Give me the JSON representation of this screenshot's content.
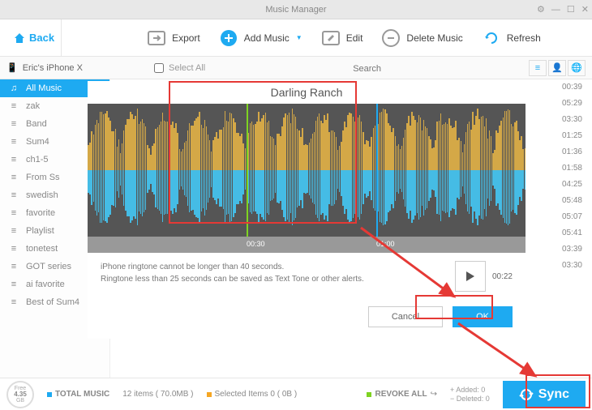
{
  "titlebar": {
    "title": "Music Manager"
  },
  "toolbar": {
    "back": "Back",
    "export": "Export",
    "add_music": "Add Music",
    "edit": "Edit",
    "delete_music": "Delete Music",
    "refresh": "Refresh"
  },
  "subheader": {
    "device": "Eric's iPhone X",
    "select_all": "Select All",
    "search_placeholder": "Search"
  },
  "sidebar": {
    "items": [
      {
        "label": "All Music",
        "icon": "♫"
      },
      {
        "label": "zak",
        "icon": "≡"
      },
      {
        "label": "Band",
        "icon": "≡"
      },
      {
        "label": "Sum4",
        "icon": "≡"
      },
      {
        "label": "ch1-5",
        "icon": "≡"
      },
      {
        "label": "From Ss",
        "icon": "≡"
      },
      {
        "label": "swedish",
        "icon": "≡"
      },
      {
        "label": "favorite",
        "icon": "≡"
      },
      {
        "label": "Playlist",
        "icon": "≡"
      },
      {
        "label": "tonetest",
        "icon": "≡"
      },
      {
        "label": "GOT series",
        "icon": "≡"
      },
      {
        "label": "ai favorite",
        "icon": "≡"
      },
      {
        "label": "Best of Sum4",
        "icon": "≡"
      }
    ]
  },
  "durations": [
    "00:39",
    "05:29",
    "03:30",
    "01:25",
    "01:36",
    "01:58",
    "04:25",
    "05:48",
    "05:07",
    "05:41",
    "03:39",
    "03:30"
  ],
  "editor": {
    "track_title": "Darling Ranch",
    "timeline": {
      "t1": "00:30",
      "t2": "01:00"
    },
    "info1": "iPhone ringtone cannot be longer than 40 seconds.",
    "info2": "Ringtone less than 25 seconds can be saved as Text Tone or other alerts.",
    "play_time": "00:22",
    "cancel": "Cancel",
    "ok": "OK"
  },
  "footer": {
    "storage_free": "Free",
    "storage_val": "4.35",
    "storage_unit": "GB",
    "total_label": "TOTAL MUSIC",
    "total_detail": "12 items ( 70.0MB )",
    "selected_detail": "Selected Items 0 ( 0B )",
    "revoke": "REVOKE ALL",
    "added": "Added: 0",
    "deleted": "Deleted: 0",
    "sync": "Sync"
  }
}
